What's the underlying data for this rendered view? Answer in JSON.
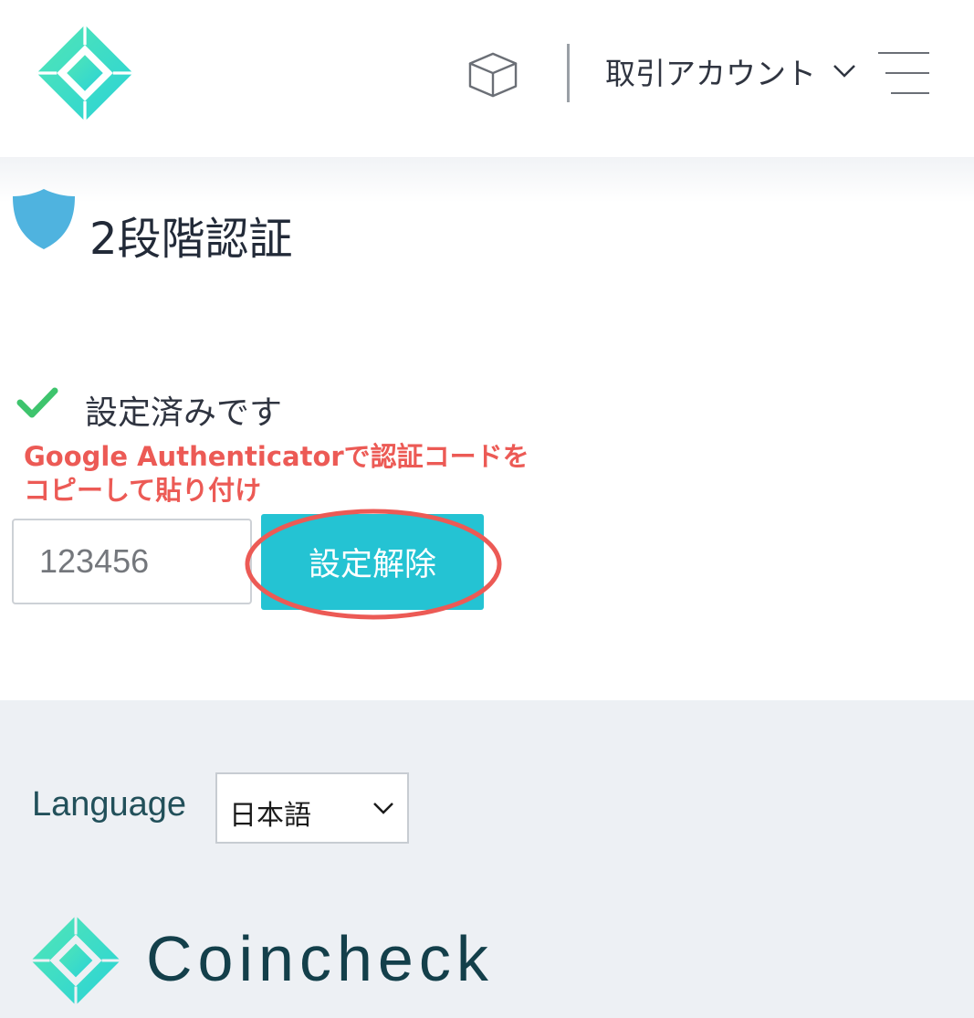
{
  "header": {
    "account_label": "取引アカウント"
  },
  "main": {
    "title": "2段階認証",
    "status": "設定済みです",
    "annotation_line1": "Google Authenticatorで認証コードを",
    "annotation_line2": "コピーして貼り付け",
    "code_placeholder": "123456",
    "unlock_button": "設定解除"
  },
  "footer": {
    "language_label": "Language",
    "language_value": "日本語",
    "brand": "Coincheck"
  },
  "icons": {
    "logo": "coincheck-logo-icon",
    "cube": "cube-icon",
    "menu": "hamburger-menu-icon",
    "shield": "shield-icon",
    "check": "check-icon",
    "chevron": "chevron-down-icon"
  },
  "colors": {
    "accent": "#24c3d3",
    "annotation": "#ec5a55",
    "check": "#3ec46d",
    "shield": "#4fb3df",
    "footer_bg": "#edf0f4"
  }
}
